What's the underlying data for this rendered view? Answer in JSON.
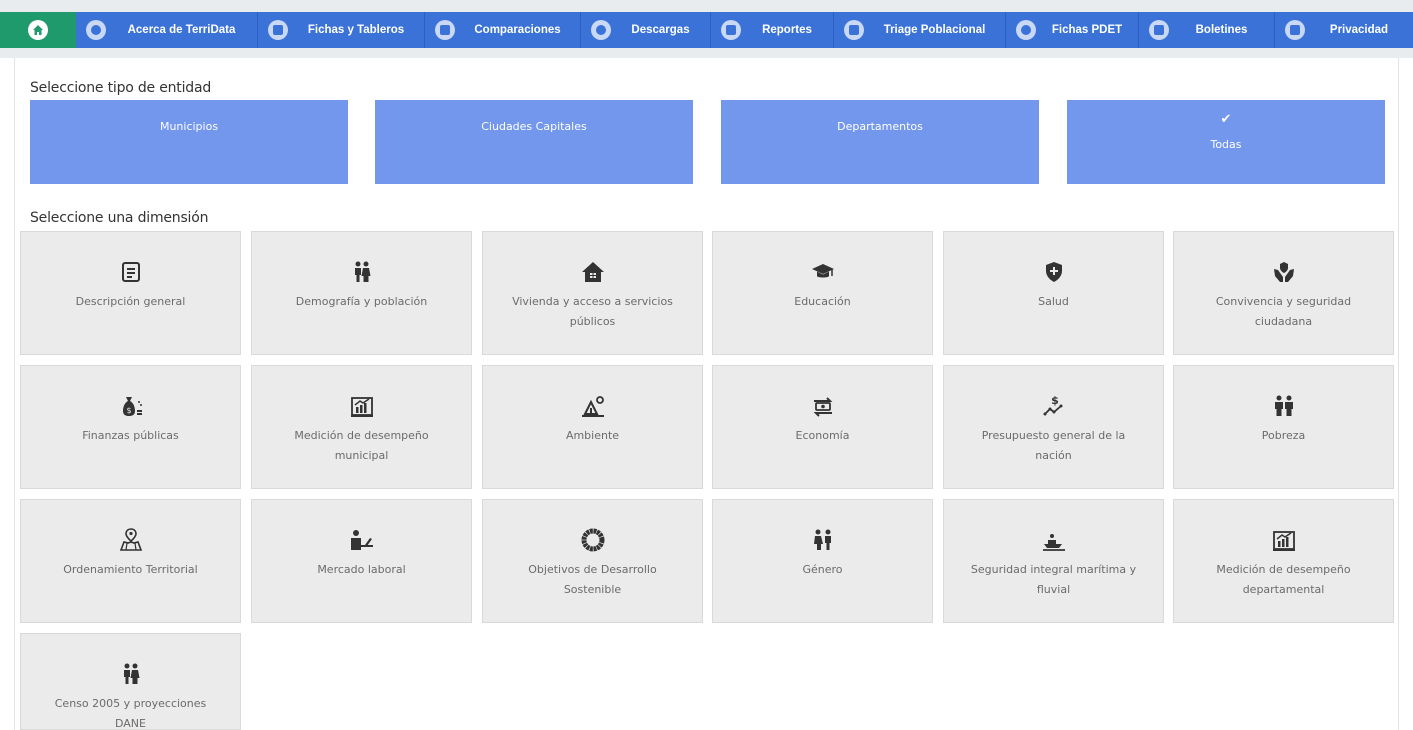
{
  "nav": {
    "items": [
      {
        "label": "Acerca de TerriData",
        "icon": "globe-icon"
      },
      {
        "label": "Fichas y Tableros",
        "icon": "document-icon"
      },
      {
        "label": "Comparaciones",
        "icon": "bar-chart-icon"
      },
      {
        "label": "Descargas",
        "icon": "cloud-download-icon"
      },
      {
        "label": "Reportes",
        "icon": "bar-chart-icon"
      },
      {
        "label": "Triage Poblacional",
        "icon": "people-icon"
      },
      {
        "label": "Fichas PDET",
        "icon": "target-icon"
      },
      {
        "label": "Boletines",
        "icon": "bulletin-icon"
      },
      {
        "label": "Privacidad",
        "icon": "lock-icon"
      }
    ]
  },
  "entity_section": {
    "title": "Seleccione tipo de entidad",
    "options": [
      {
        "label": "Municipios",
        "selected": false
      },
      {
        "label": "Ciudades Capitales",
        "selected": false
      },
      {
        "label": "Departamentos",
        "selected": false
      },
      {
        "label": "Todas",
        "selected": true
      }
    ],
    "check_glyph": "✔"
  },
  "dimension_section": {
    "title": "Seleccione una dimensión",
    "items": [
      {
        "label": "Descripción general",
        "icon": "list-document-icon"
      },
      {
        "label": "Demografía y población",
        "icon": "family-icon"
      },
      {
        "label": "Vivienda y acceso a servicios públicos",
        "icon": "house-icon"
      },
      {
        "label": "Educación",
        "icon": "graduation-cap-icon"
      },
      {
        "label": "Salud",
        "icon": "health-shield-icon"
      },
      {
        "label": "Convivencia y seguridad ciudadana",
        "icon": "hands-shield-icon"
      },
      {
        "label": "Finanzas públicas",
        "icon": "money-bag-icon"
      },
      {
        "label": "Medición de desempeño municipal",
        "icon": "growth-chart-icon"
      },
      {
        "label": "Ambiente",
        "icon": "environment-icon"
      },
      {
        "label": "Economía",
        "icon": "money-exchange-icon"
      },
      {
        "label": "Presupuesto general de la nación",
        "icon": "budget-trend-icon"
      },
      {
        "label": "Pobreza",
        "icon": "people-group-icon"
      },
      {
        "label": "Ordenamiento Territorial",
        "icon": "map-pin-icon"
      },
      {
        "label": "Mercado laboral",
        "icon": "worker-desk-icon"
      },
      {
        "label": "Objetivos de Desarrollo Sostenible",
        "icon": "sdg-wheel-icon"
      },
      {
        "label": "Género",
        "icon": "gender-icon"
      },
      {
        "label": "Seguridad integral marítima y fluvial",
        "icon": "boat-icon"
      },
      {
        "label": "Medición de desempeño departamental",
        "icon": "growth-chart-icon"
      },
      {
        "label": "Censo 2005 y proyecciones DANE",
        "icon": "family-icon"
      }
    ]
  },
  "colors": {
    "nav_bg": "#3a72d8",
    "home_bg": "#1f9a6c",
    "entity_bg": "#7397ec",
    "tile_bg": "#ebebeb",
    "icon_dark": "#333333"
  }
}
